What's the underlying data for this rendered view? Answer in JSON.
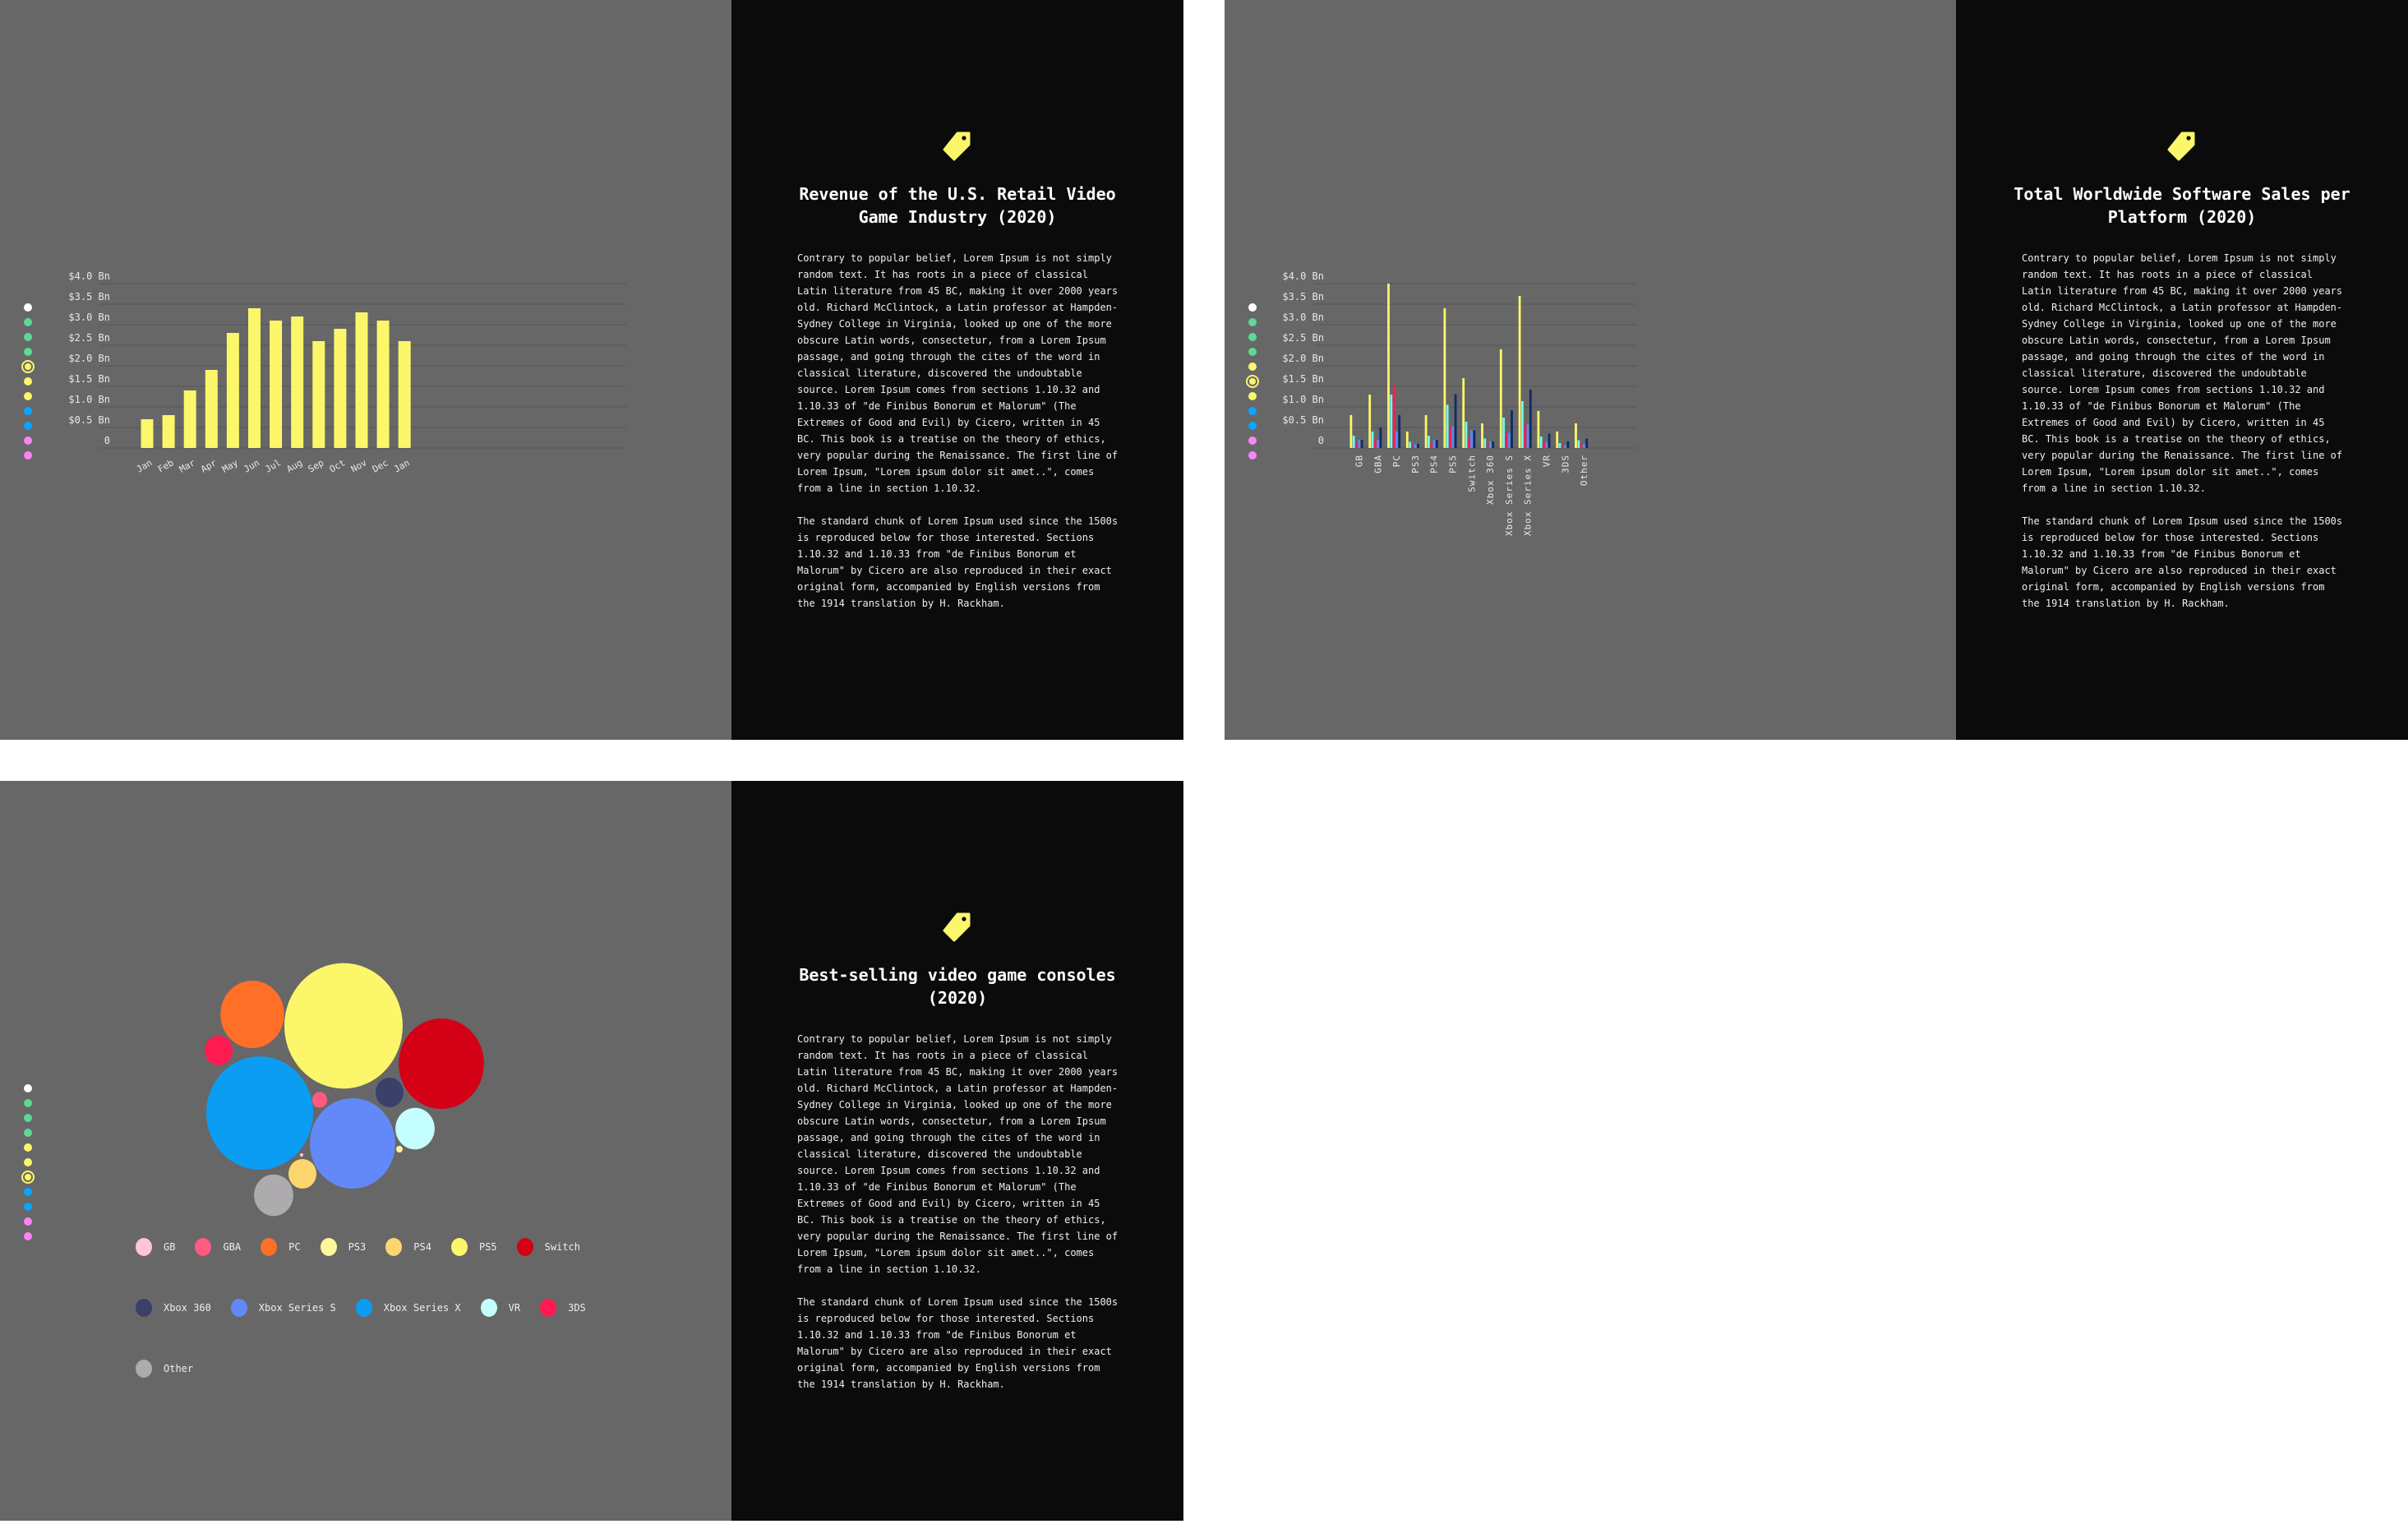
{
  "colors": {
    "panel_bg": "#676767",
    "text_bg": "#0b0b0b",
    "accent": "#fcf66a"
  },
  "nav_dots": {
    "colors": [
      "#ffffff",
      "#5fd896",
      "#5fd896",
      "#5fd896",
      "#fcf66a",
      "#fcf66a",
      "#fcf66a",
      "#0aa5ff",
      "#0aa5ff",
      "#f985f5",
      "#f985f5"
    ],
    "selected": [
      4,
      5,
      6
    ]
  },
  "body_text": [
    "Contrary to popular belief, Lorem Ipsum is not simply random text. It has roots in a piece of classical Latin literature from 45 BC, making it over 2000 years old. Richard McClintock, a Latin professor at Hampden-Sydney College in Virginia, looked up one of the more obscure Latin words, consectetur, from a Lorem Ipsum passage, and going through the cites of the word in classical literature, discovered the undoubtable source. Lorem Ipsum comes from sections 1.10.32 and 1.10.33 of \"de Finibus Bonorum et Malorum\" (The Extremes of Good and Evil) by Cicero, written in 45 BC. This book is a treatise on the theory of ethics, very popular during the Renaissance. The first line of Lorem Ipsum, \"Lorem ipsum dolor sit amet..\", comes from a line in section 1.10.32.",
    "The standard chunk of Lorem Ipsum used since the 1500s is reproduced below for those interested. Sections 1.10.32 and 1.10.33 from \"de Finibus Bonorum et Malorum\" by Cicero are also reproduced in their exact original form, accompanied by English versions from the 1914 translation by H. Rackham."
  ],
  "panels": [
    {
      "title": "Revenue of the U.S. Retail Video Game Industry (2020)",
      "icon": "tag-icon"
    },
    {
      "title": "Total Worldwide Software Sales per Platform (2020)",
      "icon": "tag-icon"
    },
    {
      "title": "Best-selling video game consoles (2020)",
      "icon": "tag-icon"
    }
  ],
  "chart_data": [
    {
      "type": "bar",
      "title": "Revenue of the U.S. Retail Video Game Industry (2020)",
      "categories": [
        "Jan",
        "Feb",
        "Mar",
        "Apr",
        "May",
        "Jun",
        "Jul",
        "Aug",
        "Sep",
        "Oct",
        "Nov",
        "Dec",
        "Jan"
      ],
      "values": [
        0.7,
        0.8,
        1.4,
        1.9,
        2.8,
        3.4,
        3.1,
        3.2,
        2.6,
        2.9,
        3.3,
        3.1,
        2.6
      ],
      "ylim": [
        0,
        4
      ],
      "yticks": [
        "0",
        "$0.5 Bn",
        "$1.0 Bn",
        "$1.5 Bn",
        "$2.0 Bn",
        "$2.5 Bn",
        "$3.0 Bn",
        "$3.5 Bn",
        "$4.0 Bn"
      ],
      "color": "#fcf66a",
      "grid": true
    },
    {
      "type": "bar",
      "title": "Total Worldwide Software Sales per Platform (2020)",
      "categories": [
        "GB",
        "GBA",
        "PC",
        "PS3",
        "PS4",
        "PS5",
        "Switch",
        "Xbox 360",
        "Xbox Series S",
        "Xbox Series X",
        "VR",
        "3DS",
        "Other"
      ],
      "series": [
        {
          "color": "#fcf66a",
          "values": [
            0.8,
            1.3,
            4.0,
            0.4,
            0.8,
            3.4,
            1.7,
            0.6,
            2.4,
            3.7,
            0.9,
            0.4,
            0.6
          ]
        },
        {
          "color": "#6ff8f0",
          "values": [
            0.3,
            0.4,
            1.3,
            0.15,
            0.3,
            1.05,
            0.64,
            0.23,
            0.74,
            1.14,
            0.28,
            0.12,
            0.19
          ]
        },
        {
          "color": "#ff1a4f",
          "values": [
            0.1,
            0.2,
            1.5,
            0.05,
            0.1,
            0.52,
            0.23,
            0.08,
            0.37,
            0.57,
            0.15,
            0.07,
            0.09
          ]
        },
        {
          "color": "#6284f5",
          "values": [
            0.2,
            0.2,
            0.4,
            0.1,
            0.2,
            0.52,
            0.43,
            0.16,
            0.37,
            0.57,
            0.15,
            0.07,
            0.1
          ]
        },
        {
          "color": "#0d2b66",
          "values": [
            0.2,
            0.5,
            0.8,
            0.1,
            0.2,
            1.31,
            0.43,
            0.16,
            0.92,
            1.42,
            0.35,
            0.16,
            0.23
          ]
        }
      ],
      "ylim": [
        0,
        4
      ],
      "yticks": [
        "0",
        "$0.5 Bn",
        "$1.0 Bn",
        "$1.5 Bn",
        "$2.0 Bn",
        "$2.5 Bn",
        "$3.0 Bn",
        "$3.5 Bn",
        "$4.0 Bn"
      ],
      "grid": true
    },
    {
      "type": "bubble",
      "title": "Best-selling video game consoles (2020)",
      "legend_placement": "bottom",
      "items": [
        {
          "name": "GB",
          "color": "#ffc4d8",
          "value": 0.08
        },
        {
          "name": "GBA",
          "color": "#ff5a80",
          "value": 1.6
        },
        {
          "name": "PC",
          "color": "#ff6f28",
          "value": 29
        },
        {
          "name": "PS3",
          "color": "#fff59a",
          "value": 0.3
        },
        {
          "name": "PS4",
          "color": "#fdd66e",
          "value": 5.6
        },
        {
          "name": "PS5",
          "color": "#fcf66a",
          "value": 100
        },
        {
          "name": "Switch",
          "color": "#d40015",
          "value": 52
        },
        {
          "name": "Xbox 360",
          "color": "#3a406a",
          "value": 5.6
        },
        {
          "name": "Xbox Series S",
          "color": "#6289f7",
          "value": 52
        },
        {
          "name": "Xbox Series X",
          "color": "#0b9df2",
          "value": 81.5
        },
        {
          "name": "VR",
          "color": "#c4fefe",
          "value": 11
        },
        {
          "name": "3DS",
          "color": "#ff1a4f",
          "value": 5.6
        },
        {
          "name": "Other",
          "color": "#aeabae",
          "value": 11
        }
      ]
    }
  ]
}
